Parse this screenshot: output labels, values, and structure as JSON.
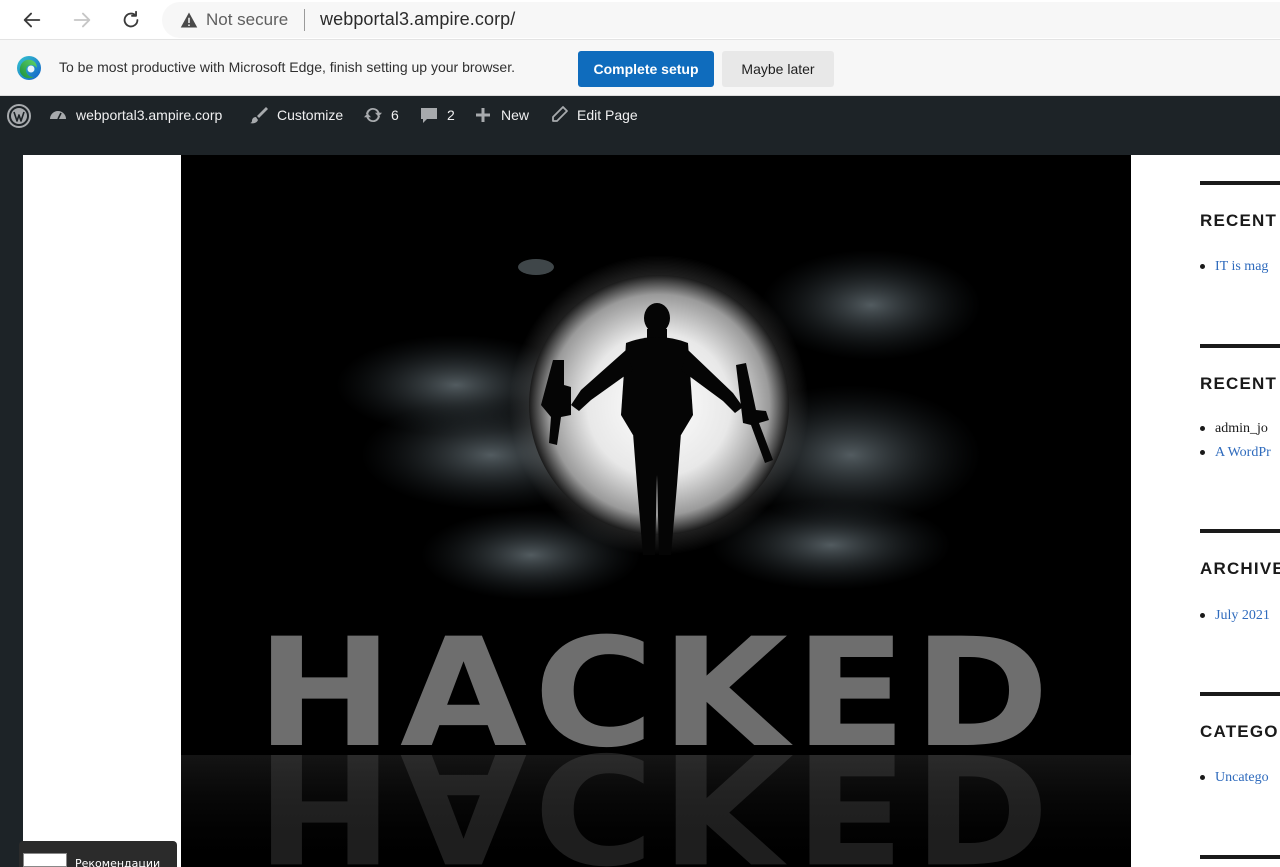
{
  "browser": {
    "security_label": "Not secure",
    "url": "webportal3.ampire.corp/",
    "icons": {
      "back": "arrow-left-icon",
      "forward": "arrow-right-icon",
      "reload": "refresh-icon",
      "warning": "warning-triangle-icon"
    }
  },
  "infobar": {
    "message": "To be most productive with Microsoft Edge, finish setting up your browser.",
    "primary_label": "Complete setup",
    "secondary_label": "Maybe later",
    "accent": "#0f6cbd"
  },
  "admin_bar": {
    "site_name": "webportal3.ampire.corp",
    "customize_label": "Customize",
    "updates_count": "6",
    "comments_count": "2",
    "new_label": "New",
    "edit_label": "Edit Page"
  },
  "hero": {
    "headline": "HACKED"
  },
  "sidebar": {
    "widgets": [
      {
        "title": "RECENT",
        "items": [
          {
            "text": "IT is mag",
            "link": true
          }
        ]
      },
      {
        "title": "RECENT",
        "items": [
          {
            "text": "admin_jo",
            "link": false
          },
          {
            "text": "A WordPr",
            "link": true
          }
        ]
      },
      {
        "title": "ARCHIVE",
        "items": [
          {
            "text": "July 2021",
            "link": true
          }
        ]
      },
      {
        "title": "CATEGO",
        "items": [
          {
            "text": "Uncatego",
            "link": true
          }
        ]
      }
    ]
  },
  "taskbar": {
    "preview_label": "Рекомендации"
  }
}
